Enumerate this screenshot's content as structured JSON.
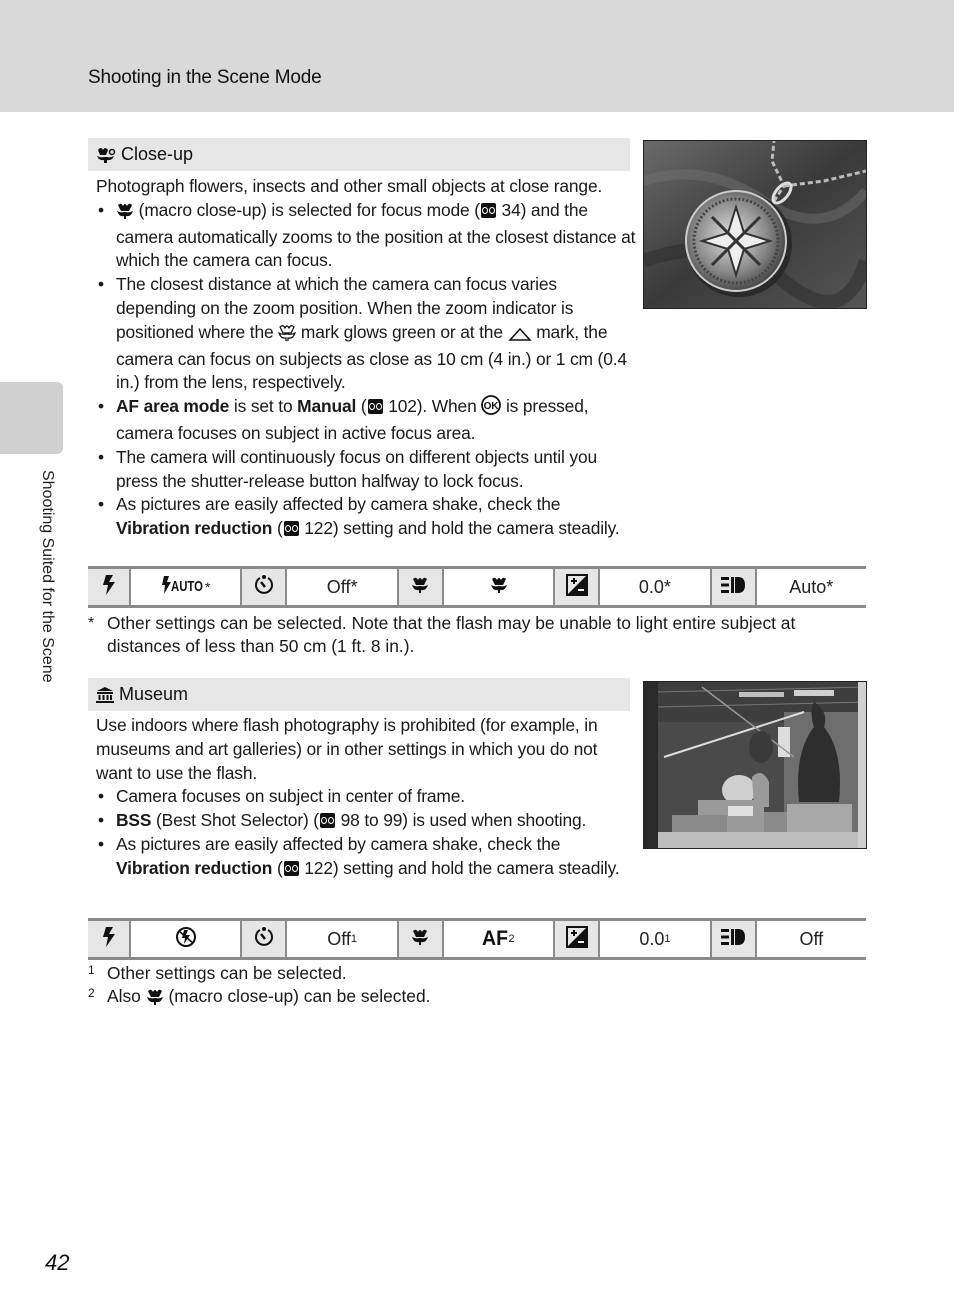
{
  "header": {
    "title": "Shooting in the Scene Mode"
  },
  "side_tab": {
    "label": "Shooting Suited for the Scene"
  },
  "page_number": "42",
  "sections": [
    {
      "icon": "close-up-icon",
      "title": "Close-up",
      "intro": "Photograph flowers, insects and other small objects at close range.",
      "bullets": [
        {
          "parts": [
            {
              "icon": "macro-icon"
            },
            {
              "t": " (macro close-up) is selected for focus mode ("
            },
            {
              "icon": "ref-icon"
            },
            {
              "t": " 34) and the camera automatically zooms to the position at the closest distance at which the camera can focus."
            }
          ]
        },
        {
          "parts": [
            {
              "t": "The closest distance at which the camera can focus varies depending on the zoom position. When the zoom indicator is positioned where the "
            },
            {
              "icon": "macro-outline-icon"
            },
            {
              "t": " mark glows green or at the "
            },
            {
              "icon": "triangle-icon"
            },
            {
              "t": " mark, the camera can focus on subjects as close as 10 cm (4 in.) or 1 cm (0.4 in.) from the lens, respectively."
            }
          ]
        },
        {
          "parts": [
            {
              "b": "AF area mode"
            },
            {
              "t": " is set to "
            },
            {
              "b": "Manual"
            },
            {
              "t": " ("
            },
            {
              "icon": "ref-icon"
            },
            {
              "t": " 102). When "
            },
            {
              "icon": "ok-icon"
            },
            {
              "t": " is pressed, camera focuses on subject in active focus area."
            }
          ]
        },
        {
          "parts": [
            {
              "t": "The camera will continuously focus on different objects until you press the shutter-release button halfway to lock focus."
            }
          ]
        },
        {
          "parts": [
            {
              "t": "As pictures are easily affected by camera shake, check the "
            },
            {
              "b": "Vibration reduction"
            },
            {
              "t": " ("
            },
            {
              "icon": "ref-icon"
            },
            {
              "t": " 122) setting and hold the camera steadily."
            }
          ]
        }
      ],
      "photo_alt": "Close-up photo of a silver pendant on fabric",
      "settings": [
        {
          "icon": "flash-icon"
        },
        {
          "value_icon": "flash-auto-icon",
          "value": "*"
        },
        {
          "icon": "self-timer-icon"
        },
        {
          "value": "Off*"
        },
        {
          "icon": "macro-icon"
        },
        {
          "value_icon": "macro-icon",
          "value": ""
        },
        {
          "icon": "exposure-compensation-icon"
        },
        {
          "value": "0.0*"
        },
        {
          "icon": "vibration-reduction-icon"
        },
        {
          "value": "Auto*"
        }
      ],
      "footnotes": [
        {
          "mark": "*",
          "text": "Other settings can be selected. Note that the flash may be unable to light entire subject at distances of less than 50 cm (1 ft. 8 in.)."
        }
      ]
    },
    {
      "icon": "museum-icon",
      "title": "Museum",
      "intro": "Use indoors where flash photography is prohibited (for example, in museums and art galleries) or in other settings in which you do not want to use the flash.",
      "bullets": [
        {
          "parts": [
            {
              "t": "Camera focuses on subject in center of frame."
            }
          ]
        },
        {
          "parts": [
            {
              "b": "BSS"
            },
            {
              "t": " (Best Shot Selector) ("
            },
            {
              "icon": "ref-icon"
            },
            {
              "t": " 98 to 99) is used when shooting."
            }
          ]
        },
        {
          "parts": [
            {
              "t": "As pictures are easily affected by camera shake, check the "
            },
            {
              "b": "Vibration reduction"
            },
            {
              "t": " ("
            },
            {
              "icon": "ref-icon"
            },
            {
              "t": " 122) setting and hold the camera steadily."
            }
          ]
        }
      ],
      "photo_alt": "Museum display case with exhibits",
      "settings": [
        {
          "icon": "flash-icon"
        },
        {
          "value_icon": "flash-off-icon",
          "value": ""
        },
        {
          "icon": "self-timer-icon"
        },
        {
          "value": "Off",
          "sup": "1"
        },
        {
          "icon": "macro-icon"
        },
        {
          "value_icon": "af-icon",
          "value": "",
          "sup": "2"
        },
        {
          "icon": "exposure-compensation-icon"
        },
        {
          "value": "0.0",
          "sup": "1"
        },
        {
          "icon": "vibration-reduction-icon"
        },
        {
          "value": "Off"
        }
      ],
      "footnotes": [
        {
          "mark": "1",
          "text": "Other settings can be selected."
        },
        {
          "mark": "2",
          "parts": [
            {
              "t": "Also "
            },
            {
              "icon": "macro-icon"
            },
            {
              "t": " (macro close-up) can be selected."
            }
          ]
        }
      ]
    }
  ]
}
